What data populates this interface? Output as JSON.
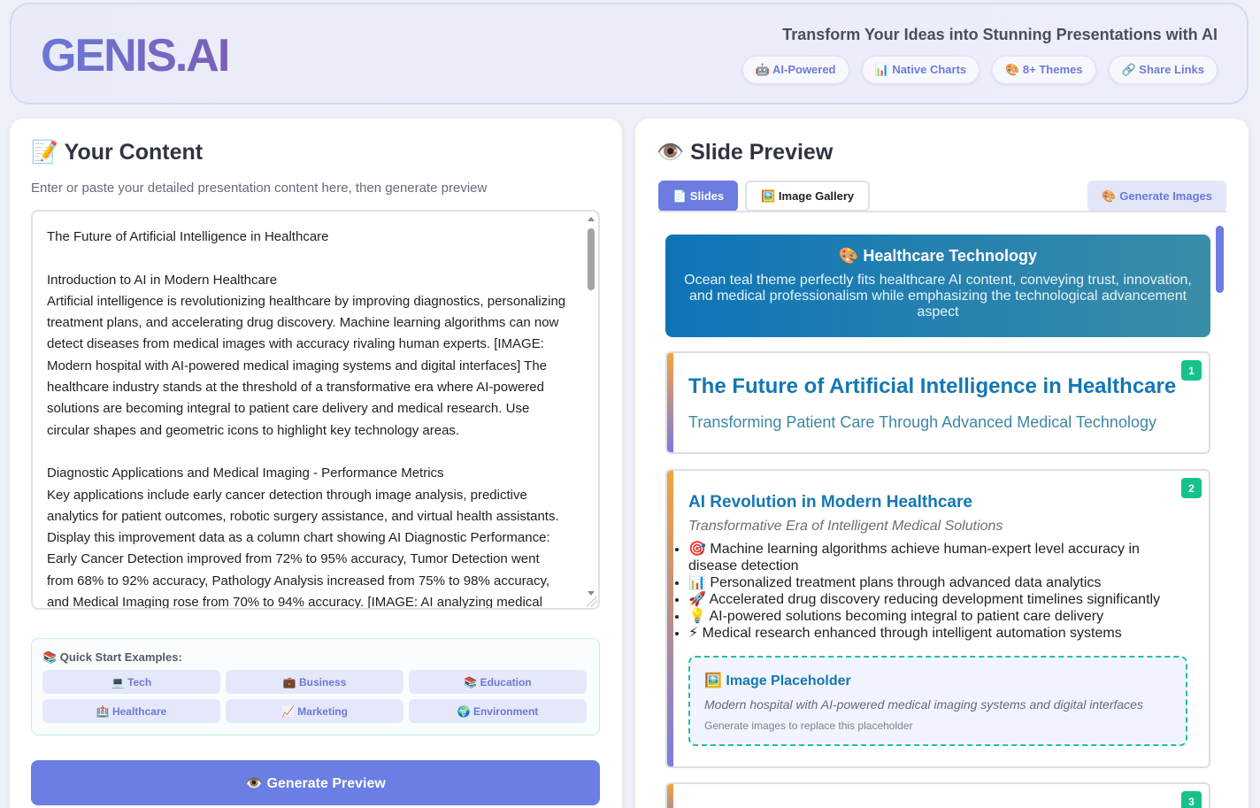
{
  "header": {
    "logo": "GENIS.AI",
    "tagline": "Transform Your Ideas into Stunning Presentations with AI",
    "badges": [
      "🤖 AI-Powered",
      "📊 Native Charts",
      "🎨 8+ Themes",
      "🔗 Share Links"
    ]
  },
  "content_panel": {
    "title": "📝 Your Content",
    "subtitle": "Enter or paste your detailed presentation content here, then generate preview",
    "editor_text": "The Future of Artificial Intelligence in Healthcare\n\nIntroduction to AI in Modern Healthcare\nArtificial intelligence is revolutionizing healthcare by improving diagnostics, personalizing treatment plans, and accelerating drug discovery. Machine learning algorithms can now detect diseases from medical images with accuracy rivaling human experts. [IMAGE: Modern hospital with AI-powered medical imaging systems and digital interfaces] The healthcare industry stands at the threshold of a transformative era where AI-powered solutions are becoming integral to patient care delivery and medical research. Use circular shapes and geometric icons to highlight key technology areas.\n\nDiagnostic Applications and Medical Imaging - Performance Metrics\nKey applications include early cancer detection through image analysis, predictive analytics for patient outcomes, robotic surgery assistance, and virtual health assistants. Display this improvement data as a column chart showing AI Diagnostic Performance: Early Cancer Detection improved from 72% to 95% accuracy, Tumor Detection went from 68% to 92% accuracy, Pathology Analysis increased from 75% to 98% accuracy, and Medical Imaging rose from 70% to 94% accuracy. [IMAGE: AI analyzing medical",
    "examples_title": "📚 Quick Start Examples:",
    "examples": [
      "💻 Tech",
      "💼 Business",
      "📚 Education",
      "🏥 Healthcare",
      "📈 Marketing",
      "🌍 Environment"
    ],
    "generate_label": "👁️ Generate Preview"
  },
  "preview_panel": {
    "title": "👁️ Slide Preview",
    "tabs": [
      "📄 Slides",
      "🖼️ Image Gallery"
    ],
    "generate_images_label": "🎨 Generate Images",
    "theme": {
      "title": "🎨 Healthcare Technology",
      "description": "Ocean teal theme perfectly fits healthcare AI content, conveying trust, innovation, and medical professionalism while emphasizing the technological advancement aspect"
    },
    "slides": [
      {
        "number": "1",
        "title": "The Future of Artificial Intelligence in Healthcare",
        "subtitle": "Transforming Patient Care Through Advanced Medical Technology"
      },
      {
        "number": "2",
        "title": "AI Revolution in Modern Healthcare",
        "subtitle": "Transformative Era of Intelligent Medical Solutions",
        "bullets": [
          "🎯 Machine learning algorithms achieve human-expert level accuracy in disease detection",
          "📊 Personalized treatment plans through advanced data analytics",
          "🚀 Accelerated drug discovery reducing development timelines significantly",
          "💡 AI-powered solutions becoming integral to patient care delivery",
          "⚡ Medical research enhanced through intelligent automation systems"
        ],
        "placeholder": {
          "title": "🖼️ Image Placeholder",
          "description": "Modern hospital with AI-powered medical imaging systems and digital interfaces",
          "hint": "Generate images to replace this placeholder"
        }
      },
      {
        "number": "3"
      }
    ]
  }
}
